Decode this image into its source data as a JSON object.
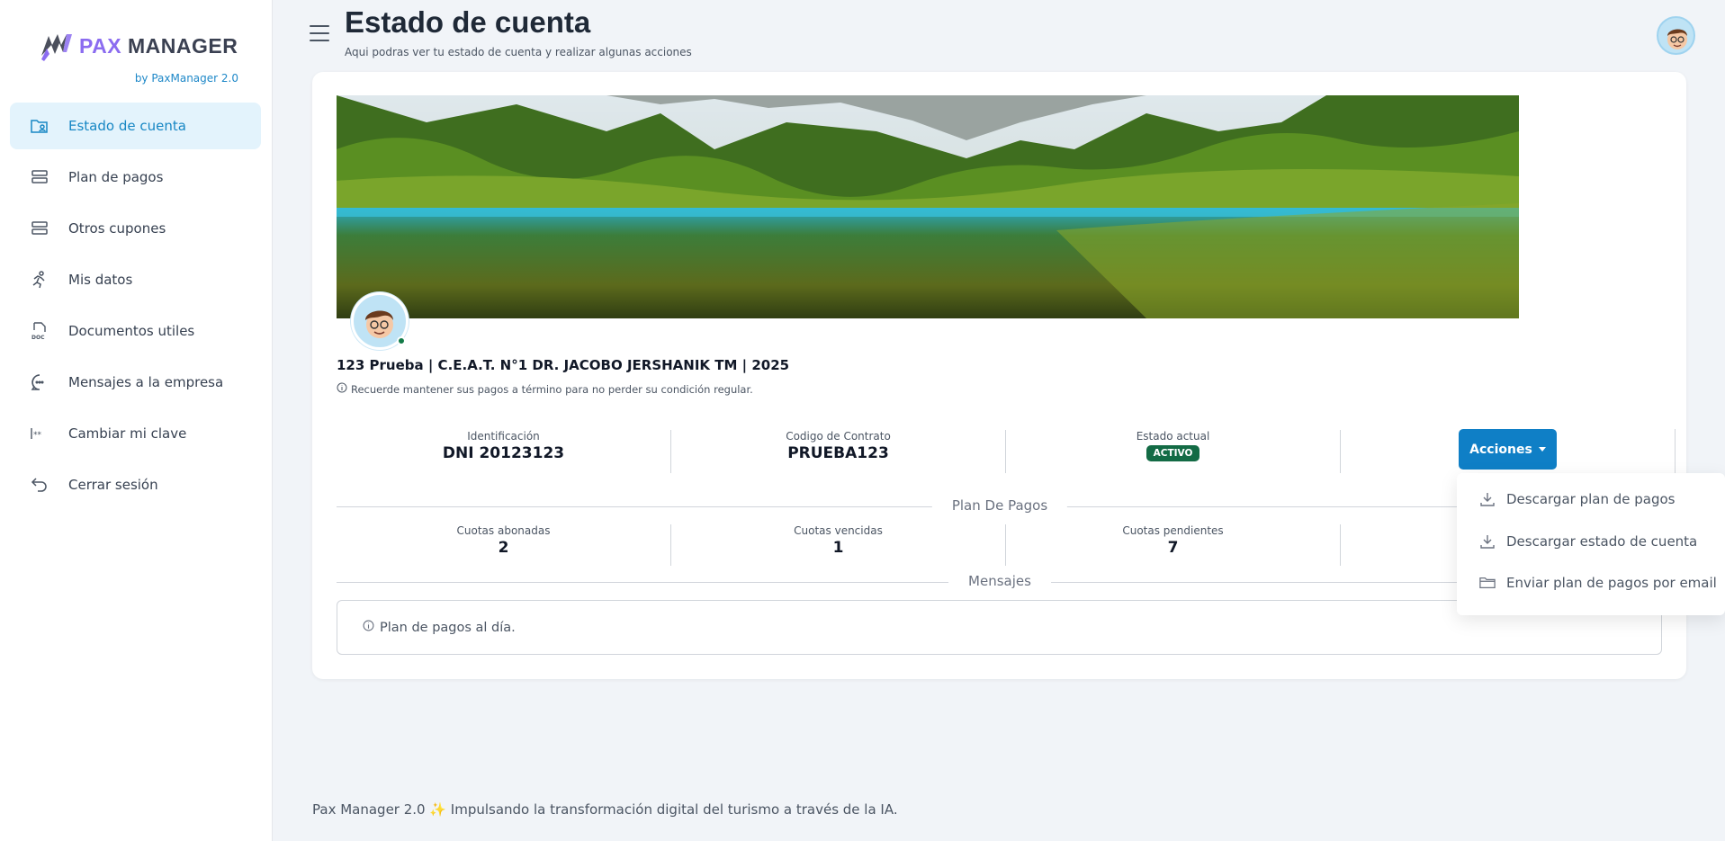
{
  "brand": {
    "pax": "PAX",
    "manager": "MANAGER",
    "subtitle": "by PaxManager 2.0"
  },
  "sidebar": {
    "items": [
      {
        "label": "Estado de cuenta",
        "icon": "folder-user-icon",
        "active": true
      },
      {
        "label": "Plan de pagos",
        "icon": "server-icon"
      },
      {
        "label": "Otros cupones",
        "icon": "server-icon"
      },
      {
        "label": "Mis datos",
        "icon": "running-person-icon"
      },
      {
        "label": "Documentos utiles",
        "icon": "document-icon"
      },
      {
        "label": "Mensajes a la empresa",
        "icon": "chat-bubble-icon"
      },
      {
        "label": "Cambiar mi clave",
        "icon": "password-icon"
      },
      {
        "label": "Cerrar sesión",
        "icon": "logout-arrow-icon"
      }
    ]
  },
  "header": {
    "title": "Estado de cuenta",
    "subtitle": "Aqui podras ver tu estado de cuenta y realizar algunas acciones"
  },
  "profile": {
    "name": "123 Prueba | C.E.A.T. N°1 DR. JACOBO JERSHANIK TM | 2025",
    "note": "Recuerde mantener sus pagos a término para no perder su condición regular."
  },
  "stats": {
    "identificacion_label": "Identificación",
    "identificacion_value": "DNI 20123123",
    "contrato_label": "Codigo de Contrato",
    "contrato_value": "PRUEBA123",
    "estado_label": "Estado actual",
    "estado_value": "ACTIVO",
    "acciones_label": "Acciones"
  },
  "plan": {
    "title": "Plan De Pagos",
    "abonadas_label": "Cuotas abonadas",
    "abonadas_value": "2",
    "vencidas_label": "Cuotas vencidas",
    "vencidas_value": "1",
    "pendientes_label": "Cuotas pendientes",
    "pendientes_value": "7"
  },
  "mensajes": {
    "title": "Mensajes",
    "text": "Plan de pagos al día."
  },
  "dropdown": {
    "items": [
      {
        "label": "Descargar plan de pagos",
        "icon": "download-icon"
      },
      {
        "label": "Descargar estado de cuenta",
        "icon": "download-icon"
      },
      {
        "label": "Enviar plan de pagos por email",
        "icon": "folder-icon"
      }
    ]
  },
  "footer": {
    "text": "Pax Manager 2.0 ✨ Impulsando la transformación digital del turismo a través de la IA."
  },
  "colors": {
    "accent": "#0f7fc6",
    "brand_purple": "#8b6cf0",
    "status_active": "#136b45",
    "active_nav_bg": "#e3f3fc"
  }
}
